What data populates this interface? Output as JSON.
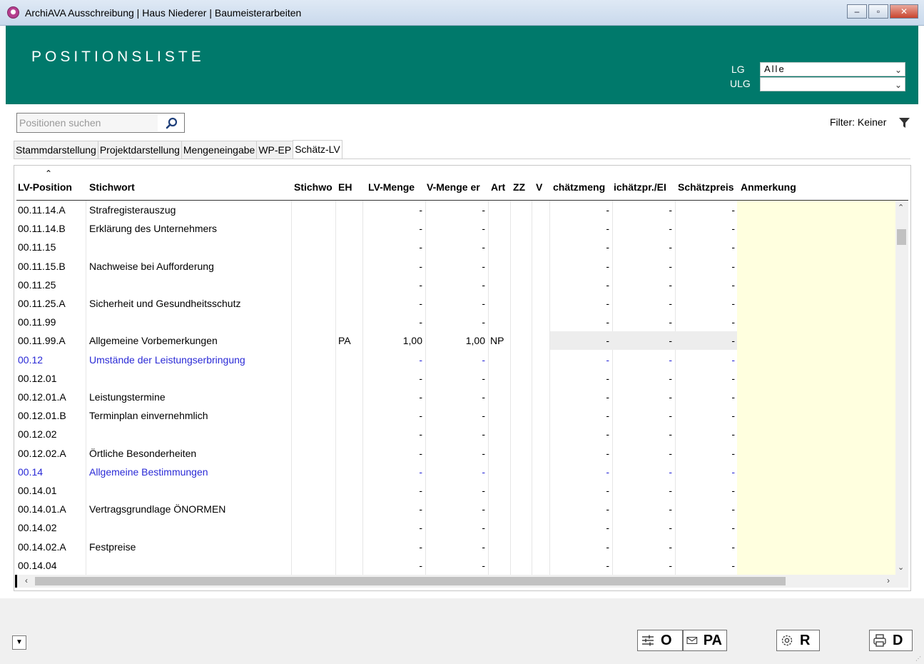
{
  "window": {
    "title": "ArchiAVA Ausschreibung | Haus Niederer | Baumeisterarbeiten",
    "minimize": "–",
    "maximize": "▫",
    "close": "✕"
  },
  "header": {
    "title": "POSITIONSLISTE",
    "lg_label": "LG",
    "lg_value": "Alle",
    "ulg_label": "ULG",
    "ulg_value": ""
  },
  "search": {
    "placeholder": "Positionen suchen"
  },
  "filter": {
    "label": "Filter: Keiner"
  },
  "tabs": [
    {
      "label": "Stammdarstellung"
    },
    {
      "label": "Projektdarstellung"
    },
    {
      "label": "Mengeneingabe"
    },
    {
      "label": "WP-EP"
    },
    {
      "label": "Schätz-LV",
      "active": true
    }
  ],
  "columns": [
    {
      "label": "LV-Position"
    },
    {
      "label": "Stichwort"
    },
    {
      "label": "Stichwo"
    },
    {
      "label": "EH"
    },
    {
      "label": "LV-Menge"
    },
    {
      "label": "V-Menge er"
    },
    {
      "label": "Art"
    },
    {
      "label": "ZZ"
    },
    {
      "label": "V"
    },
    {
      "label": "chätzmeng"
    },
    {
      "label": "ichätzpr./EI"
    },
    {
      "label": "Schätzpreis"
    },
    {
      "label": "Anmerkung"
    }
  ],
  "rows": [
    {
      "pos": "00.11.14.A",
      "stichwort": "Strafregisterauszug",
      "eh": "",
      "lvmenge": "-",
      "vmenge": "-",
      "art": "",
      "schmenge": "-",
      "schpreis_eh": "-",
      "schpreis": "-"
    },
    {
      "pos": "00.11.14.B",
      "stichwort": "Erklärung des Unternehmers",
      "eh": "",
      "lvmenge": "-",
      "vmenge": "-",
      "art": "",
      "schmenge": "-",
      "schpreis_eh": "-",
      "schpreis": "-"
    },
    {
      "pos": "00.11.15",
      "stichwort": "",
      "eh": "",
      "lvmenge": "-",
      "vmenge": "-",
      "art": "",
      "schmenge": "-",
      "schpreis_eh": "-",
      "schpreis": "-"
    },
    {
      "pos": "00.11.15.B",
      "stichwort": "Nachweise bei Aufforderung",
      "eh": "",
      "lvmenge": "-",
      "vmenge": "-",
      "art": "",
      "schmenge": "-",
      "schpreis_eh": "-",
      "schpreis": "-"
    },
    {
      "pos": "00.11.25",
      "stichwort": "",
      "eh": "",
      "lvmenge": "-",
      "vmenge": "-",
      "art": "",
      "schmenge": "-",
      "schpreis_eh": "-",
      "schpreis": "-"
    },
    {
      "pos": "00.11.25.A",
      "stichwort": "Sicherheit und Gesundheitsschutz",
      "eh": "",
      "lvmenge": "-",
      "vmenge": "-",
      "art": "",
      "schmenge": "-",
      "schpreis_eh": "-",
      "schpreis": "-"
    },
    {
      "pos": "00.11.99",
      "stichwort": "",
      "eh": "",
      "lvmenge": "-",
      "vmenge": "-",
      "art": "",
      "schmenge": "-",
      "schpreis_eh": "-",
      "schpreis": "-"
    },
    {
      "pos": "00.11.99.A",
      "stichwort": "Allgemeine Vorbemerkungen",
      "eh": "PA",
      "lvmenge": "1,00",
      "vmenge": "1,00",
      "art": "NP",
      "schmenge": "-",
      "schpreis_eh": "-",
      "schpreis": "-",
      "highlight": true
    },
    {
      "pos": "00.12",
      "stichwort": "Umstände der Leistungserbringung",
      "eh": "",
      "lvmenge": "-",
      "vmenge": "-",
      "art": "",
      "schmenge": "-",
      "schpreis_eh": "-",
      "schpreis": "-",
      "group": true
    },
    {
      "pos": "00.12.01",
      "stichwort": "",
      "eh": "",
      "lvmenge": "-",
      "vmenge": "-",
      "art": "",
      "schmenge": "-",
      "schpreis_eh": "-",
      "schpreis": "-"
    },
    {
      "pos": "00.12.01.A",
      "stichwort": "Leistungstermine",
      "eh": "",
      "lvmenge": "-",
      "vmenge": "-",
      "art": "",
      "schmenge": "-",
      "schpreis_eh": "-",
      "schpreis": "-"
    },
    {
      "pos": "00.12.01.B",
      "stichwort": "Terminplan einvernehmlich",
      "eh": "",
      "lvmenge": "-",
      "vmenge": "-",
      "art": "",
      "schmenge": "-",
      "schpreis_eh": "-",
      "schpreis": "-"
    },
    {
      "pos": "00.12.02",
      "stichwort": "",
      "eh": "",
      "lvmenge": "-",
      "vmenge": "-",
      "art": "",
      "schmenge": "-",
      "schpreis_eh": "-",
      "schpreis": "-"
    },
    {
      "pos": "00.12.02.A",
      "stichwort": "Örtliche Besonderheiten",
      "eh": "",
      "lvmenge": "-",
      "vmenge": "-",
      "art": "",
      "schmenge": "-",
      "schpreis_eh": "-",
      "schpreis": "-"
    },
    {
      "pos": "00.14",
      "stichwort": "Allgemeine Bestimmungen",
      "eh": "",
      "lvmenge": "-",
      "vmenge": "-",
      "art": "",
      "schmenge": "-",
      "schpreis_eh": "-",
      "schpreis": "-",
      "group": true
    },
    {
      "pos": "00.14.01",
      "stichwort": "",
      "eh": "",
      "lvmenge": "-",
      "vmenge": "-",
      "art": "",
      "schmenge": "-",
      "schpreis_eh": "-",
      "schpreis": "-"
    },
    {
      "pos": "00.14.01.A",
      "stichwort": "Vertragsgrundlage ÖNORMEN",
      "eh": "",
      "lvmenge": "-",
      "vmenge": "-",
      "art": "",
      "schmenge": "-",
      "schpreis_eh": "-",
      "schpreis": "-"
    },
    {
      "pos": "00.14.02",
      "stichwort": "",
      "eh": "",
      "lvmenge": "-",
      "vmenge": "-",
      "art": "",
      "schmenge": "-",
      "schpreis_eh": "-",
      "schpreis": "-"
    },
    {
      "pos": "00.14.02.A",
      "stichwort": "Festpreise",
      "eh": "",
      "lvmenge": "-",
      "vmenge": "-",
      "art": "",
      "schmenge": "-",
      "schpreis_eh": "-",
      "schpreis": "-"
    },
    {
      "pos": "00.14.04",
      "stichwort": "",
      "eh": "",
      "lvmenge": "-",
      "vmenge": "-",
      "art": "",
      "schmenge": "-",
      "schpreis_eh": "-",
      "schpreis": "-"
    }
  ],
  "toolbar": {
    "btn_o": "O",
    "btn_pa": "PA",
    "btn_r": "R",
    "btn_d": "D"
  },
  "colors": {
    "header_bg": "#00796b",
    "group_text": "#2a2ad6",
    "anmerkung_bg": "#ffffdf",
    "highlight_bg": "#ededed"
  },
  "icons": [
    "app-icon",
    "search-icon",
    "filter-icon",
    "sort-ascending-icon",
    "chevron-down-icon",
    "sliders-icon",
    "mail-icon",
    "gear-icon",
    "printer-icon"
  ]
}
